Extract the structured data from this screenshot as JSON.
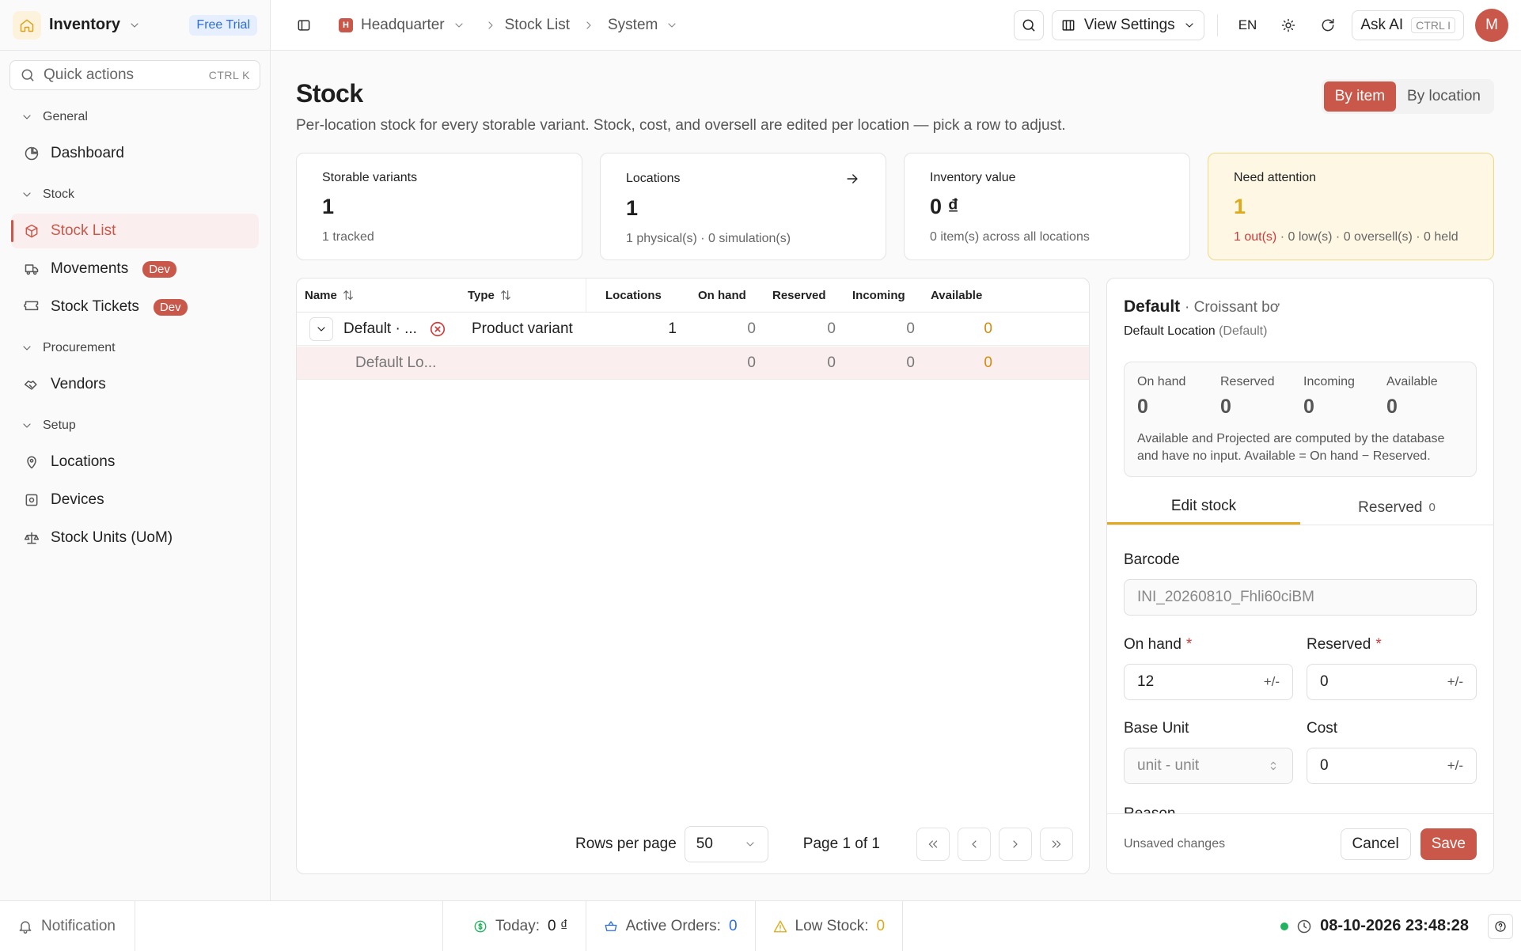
{
  "sidebar": {
    "brand": "Inventory",
    "trial": "Free Trial",
    "quick_actions": "Quick actions",
    "quick_kbd": "CTRL K",
    "groups": {
      "general": "General",
      "stock": "Stock",
      "procurement": "Procurement",
      "setup": "Setup"
    },
    "items": {
      "dashboard": "Dashboard",
      "stock_list": "Stock List",
      "movements": "Movements",
      "stock_tickets": "Stock Tickets",
      "vendors": "Vendors",
      "locations": "Locations",
      "devices": "Devices",
      "stock_units": "Stock Units (UoM)"
    },
    "dev_badge": "Dev"
  },
  "topbar": {
    "crumbs": [
      "Headquarter",
      "Stock List",
      "System"
    ],
    "hq_badge": "H",
    "view_settings": "View Settings",
    "lang": "EN",
    "ask_ai": "Ask AI",
    "ask_kbd": "CTRL I",
    "avatar": "M"
  },
  "page": {
    "title": "Stock",
    "subtitle": "Per-location stock for every storable variant. Stock, cost, and oversell are edited per location — pick a row to adjust.",
    "toggle": [
      "By item",
      "By location"
    ]
  },
  "cards": [
    {
      "label": "Storable variants",
      "value": "1",
      "sub": "1 tracked"
    },
    {
      "label": "Locations",
      "value": "1",
      "sub": "1 physical(s) · 0 simulation(s)"
    },
    {
      "label": "Inventory value",
      "value": "0 ₫",
      "sub": "0 item(s) across all locations"
    },
    {
      "label": "Need attention",
      "value": "1",
      "sub_red": "1 out(s)",
      "sub_rest": " · 0 low(s) · 0 oversell(s) · 0 held"
    }
  ],
  "table": {
    "headers": [
      "Name",
      "Type",
      "Locations",
      "On hand",
      "Reserved",
      "Incoming",
      "Available"
    ],
    "rows": [
      {
        "name": "Default · ...",
        "type": "Product variant",
        "locations": "1",
        "on_hand": "0",
        "reserved": "0",
        "incoming": "0",
        "available": "0"
      },
      {
        "name": "Default Lo...",
        "type": "",
        "locations": "",
        "on_hand": "0",
        "reserved": "0",
        "incoming": "0",
        "available": "0"
      }
    ],
    "rows_per_page_label": "Rows per page",
    "rows_per_page": "50",
    "page_info": "Page 1 of 1"
  },
  "panel": {
    "title": "Default",
    "title_sub": "· Croissant bơ",
    "location": "Default Location",
    "location_sub": "(Default)",
    "stats": [
      {
        "label": "On hand",
        "value": "0"
      },
      {
        "label": "Reserved",
        "value": "0"
      },
      {
        "label": "Incoming",
        "value": "0"
      },
      {
        "label": "Available",
        "value": "0"
      }
    ],
    "note": "Available and Projected are computed by the database and have no input. Available = On hand − Reserved.",
    "tabs": {
      "edit": "Edit stock",
      "reserved": "Reserved",
      "reserved_count": "0"
    },
    "fields": {
      "barcode_label": "Barcode",
      "barcode": "INI_20260810_Fhli60ciBM",
      "on_hand_label": "On hand",
      "on_hand": "12",
      "reserved_label": "Reserved",
      "reserved": "0",
      "base_unit_label": "Base Unit",
      "base_unit": "unit - unit",
      "cost_label": "Cost",
      "cost": "0",
      "reason_label": "Reason",
      "pm": "+/-",
      "req": "*"
    },
    "unsaved": "Unsaved changes",
    "cancel": "Cancel",
    "save": "Save"
  },
  "statusbar": {
    "notification": "Notification",
    "today_label": "Today:",
    "today": "0 ₫",
    "orders_label": "Active Orders:",
    "orders": "0",
    "low_label": "Low Stock:",
    "low": "0",
    "datetime": "08-10-2026 23:48:28"
  },
  "colors": {
    "accent": "#c9584a",
    "warn": "#e0a91c",
    "danger": "#d23b3b",
    "online": "#22b35e"
  }
}
